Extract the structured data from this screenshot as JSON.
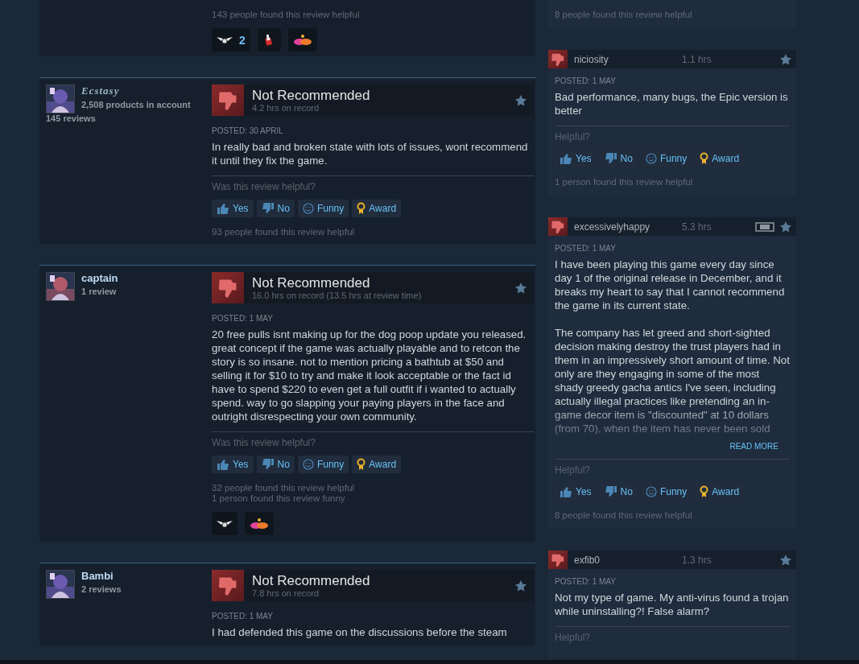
{
  "left_reviews": [
    {
      "kind": "tail",
      "stats": [
        "143 people found this review helpful"
      ],
      "awards": [
        {
          "kind": "wings",
          "count": "2"
        },
        {
          "kind": "bottle"
        },
        {
          "kind": "hands"
        }
      ]
    },
    {
      "kind": "full",
      "author": {
        "name": "Ecstasy",
        "fancy": true,
        "products": "2,508 products in account",
        "reviews": "145 reviews"
      },
      "verdict": "Not Recommended",
      "hours": "4.2 hrs on record",
      "posted": "POSTED: 30 APRIL",
      "paragraphs": [
        "In really bad and broken state with lots of issues, wont recommend it until they fix the game."
      ],
      "helpful_prompt": "Was this review helpful?",
      "buttons": [
        {
          "kind": "yes",
          "label": "Yes"
        },
        {
          "kind": "no",
          "label": "No"
        },
        {
          "kind": "funny",
          "label": "Funny"
        },
        {
          "kind": "award",
          "label": "Award"
        }
      ],
      "stats": [
        "93 people found this review helpful"
      ]
    },
    {
      "kind": "full",
      "author": {
        "name": "captain",
        "fancy": false,
        "reviews": "1 review"
      },
      "verdict": "Not Recommended",
      "hours": "16.0 hrs on record (13.5 hrs at review time)",
      "posted": "POSTED: 1 MAY",
      "paragraphs": [
        "20 free pulls isnt making up for the dog poop update you released. great concept if the game was actually playable and to retcon the story is so insane. not to mention pricing a bathtub at $50 and selling it for $10 to try and make it look acceptable or the fact id have to spend $220 to even get a full outfit if i wanted to actually spend. way to go slapping your paying players in the face and outright disrespecting your own community."
      ],
      "helpful_prompt": "Was this review helpful?",
      "buttons": [
        {
          "kind": "yes",
          "label": "Yes"
        },
        {
          "kind": "no",
          "label": "No"
        },
        {
          "kind": "funny",
          "label": "Funny"
        },
        {
          "kind": "award",
          "label": "Award"
        }
      ],
      "stats": [
        "32 people found this review helpful",
        "1 person found this review funny"
      ],
      "awards": [
        {
          "kind": "wings"
        },
        {
          "kind": "hands"
        }
      ]
    },
    {
      "kind": "full",
      "author": {
        "name": "Bambi",
        "fancy": false,
        "reviews": "2 reviews"
      },
      "verdict": "Not Recommended",
      "hours": "7.8 hrs on record",
      "posted": "POSTED: 1 MAY",
      "paragraphs": [
        "I had defended this game on the discussions before the steam"
      ]
    }
  ],
  "right_reviews": [
    {
      "kind": "tail",
      "stats": [
        "8 people found this review helpful"
      ]
    },
    {
      "kind": "full",
      "author": "niciosity",
      "hours": "1.1 hrs",
      "deck": false,
      "posted": "POSTED: 1 MAY",
      "paragraphs": [
        "Bad performance, many bugs, the Epic version is better"
      ],
      "helpful_prompt": "Helpful?",
      "buttons": [
        {
          "kind": "yes",
          "label": "Yes"
        },
        {
          "kind": "no",
          "label": "No"
        },
        {
          "kind": "funny",
          "label": "Funny"
        },
        {
          "kind": "award",
          "label": "Award"
        }
      ],
      "stats": [
        "1 person found this review helpful"
      ]
    },
    {
      "kind": "full",
      "author": "excessivelyhappy",
      "hours": "5.3 hrs",
      "deck": true,
      "posted": "POSTED: 1 MAY",
      "paragraphs": [
        "I have been playing this game every day since day 1 of the original release in December, and it breaks my heart to say that I cannot recommend the game in its current state.",
        "The company has let greed and short-sighted decision making destroy the trust players had in them in an impressively short amount of time. Not only are they engaging in some of the most shady greedy gacha antics I've seen, including actually illegal practices like pretending an in-game decor item is \"discounted\" at 10 dollars (from 70), when the item has never been sold"
      ],
      "read_more": "READ MORE",
      "helpful_prompt": "Helpful?",
      "buttons": [
        {
          "kind": "yes",
          "label": "Yes"
        },
        {
          "kind": "no",
          "label": "No"
        },
        {
          "kind": "funny",
          "label": "Funny"
        },
        {
          "kind": "award",
          "label": "Award"
        }
      ],
      "stats": [
        "8 people found this review helpful"
      ]
    },
    {
      "kind": "full",
      "author": "exfib0",
      "hours": "1.3 hrs",
      "deck": false,
      "posted": "POSTED: 1 MAY",
      "paragraphs": [
        "Not my type of game. My anti-virus found a trojan while uninstalling?! False alarm?"
      ],
      "helpful_prompt": "Helpful?"
    }
  ]
}
